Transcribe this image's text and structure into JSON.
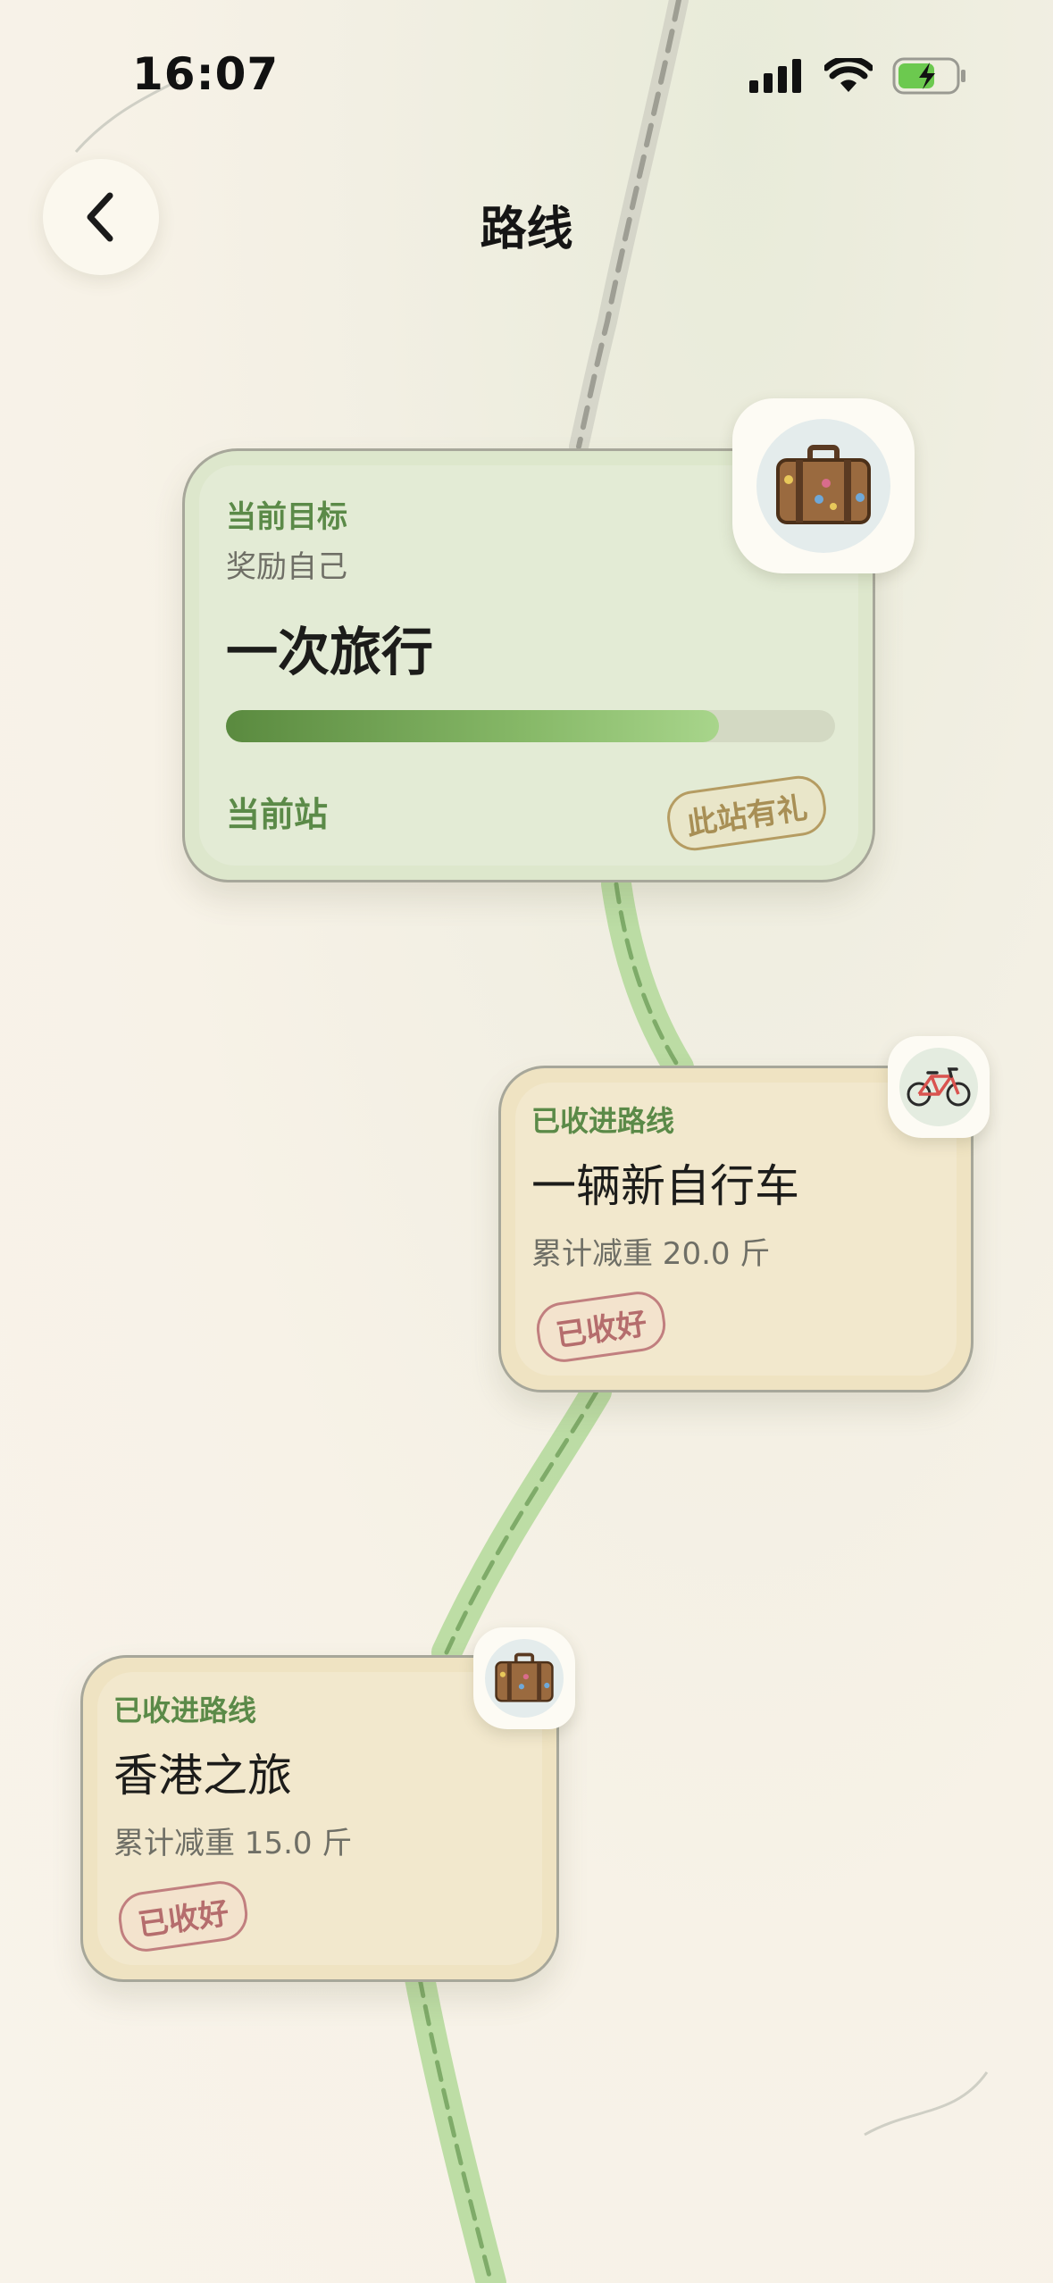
{
  "status_bar": {
    "time": "16:07",
    "icons": [
      "cellular-signal-icon",
      "wifi-icon",
      "battery-charging-icon"
    ]
  },
  "nav": {
    "back_icon": "chevron-left-icon",
    "title": "路线"
  },
  "current_goal": {
    "section_label": "当前目标",
    "subtitle": "奖励自己",
    "title": "一次旅行",
    "progress": 0.81,
    "station_label": "当前站",
    "gift_stamp": "此站有礼",
    "icon": "suitcase-icon"
  },
  "collected_routes": [
    {
      "section_label": "已收进路线",
      "title": "一辆新自行车",
      "weight_text": "累计减重 20.0 斤",
      "stamp": "已收好",
      "icon": "bicycle-icon"
    },
    {
      "section_label": "已收进路线",
      "title": "香港之旅",
      "weight_text": "累计减重 15.0 斤",
      "stamp": "已收好",
      "icon": "suitcase-icon"
    }
  ],
  "colors": {
    "accent_green": "#5b8a48",
    "progress_green": "#86b867",
    "card_current_bg": "#dde7cc",
    "card_done_bg": "#efe3c2",
    "stamp_red": "#b56d6d",
    "stamp_gold": "#a88f55",
    "route_green": "#9fcf86"
  }
}
